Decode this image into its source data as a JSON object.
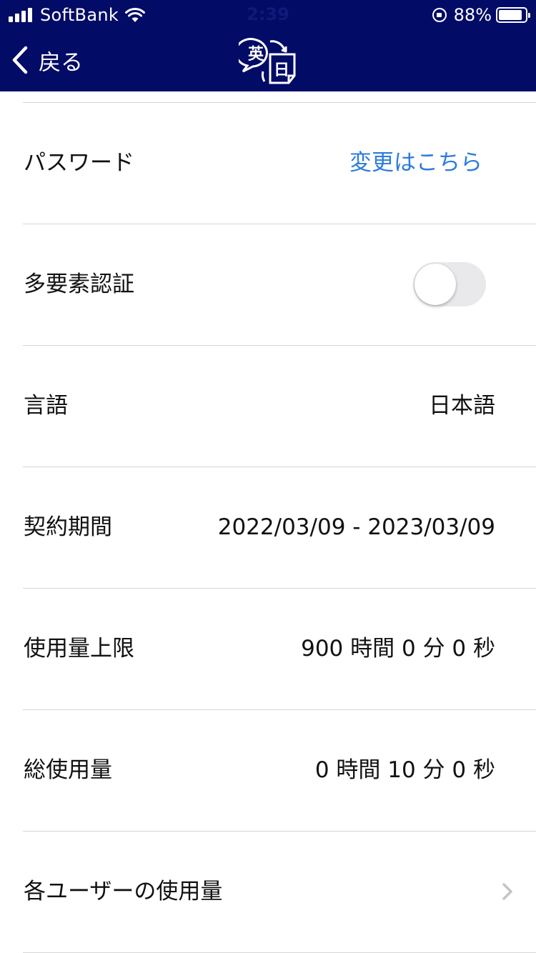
{
  "status_bar": {
    "carrier": "SoftBank",
    "time": "2:39",
    "battery_percent": "88%",
    "signal_bars": 4
  },
  "nav": {
    "back_label": "戻る",
    "logo_icon": "translation-logo-icon",
    "logo_text_en": "英",
    "logo_text_ja": "日"
  },
  "colors": {
    "header_bg": "#020b66",
    "link": "#2b7cdc",
    "toggle_off": "#e9e9eb",
    "separator": "#d6d6d6"
  },
  "settings": {
    "password": {
      "label": "パスワード",
      "action": "変更はこちら"
    },
    "mfa": {
      "label": "多要素認証",
      "enabled": false
    },
    "language": {
      "label": "言語",
      "value": "日本語"
    },
    "contract_period": {
      "label": "契約期間",
      "value": "2022/03/09 - 2023/03/09"
    },
    "usage_limit": {
      "label": "使用量上限",
      "value": "900 時間 0 分 0 秒"
    },
    "total_usage": {
      "label": "総使用量",
      "value": "0 時間 10 分 0 秒"
    },
    "per_user_usage": {
      "label": "各ユーザーの使用量"
    }
  }
}
